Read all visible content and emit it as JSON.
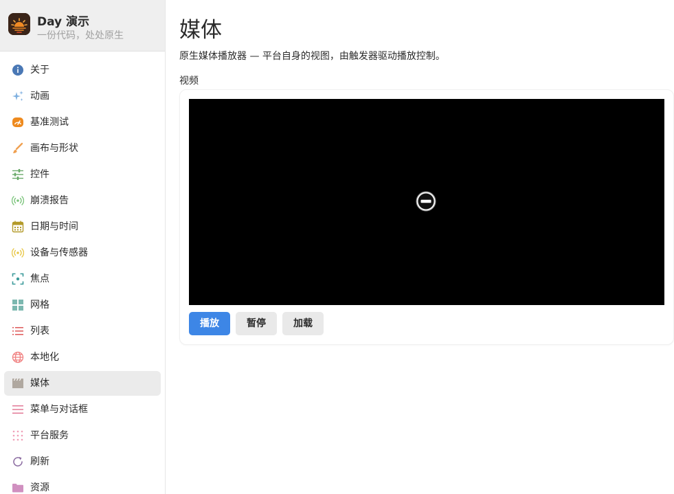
{
  "app": {
    "title": "Day 演示",
    "subtitle": "一份代码，处处原生"
  },
  "sidebar": {
    "items": [
      {
        "label": "关于",
        "icon": "info-icon",
        "color": "#4a78b5"
      },
      {
        "label": "动画",
        "icon": "sparkles-icon",
        "color": "#7fb0e0"
      },
      {
        "label": "基准测试",
        "icon": "speedometer-icon",
        "color": "#ee8a1e"
      },
      {
        "label": "画布与形状",
        "icon": "brush-icon",
        "color": "#f0a050"
      },
      {
        "label": "控件",
        "icon": "sliders-icon",
        "color": "#6aaa6a"
      },
      {
        "label": "崩溃报告",
        "icon": "broadcast-icon",
        "color": "#7cc47c"
      },
      {
        "label": "日期与时间",
        "icon": "calendar-icon",
        "color": "#b39a2a"
      },
      {
        "label": "设备与传感器",
        "icon": "sensor-icon",
        "color": "#e8c84a"
      },
      {
        "label": "焦点",
        "icon": "focus-icon",
        "color": "#3a9a9a"
      },
      {
        "label": "网格",
        "icon": "grid-icon",
        "color": "#7cb8b0"
      },
      {
        "label": "列表",
        "icon": "list-icon",
        "color": "#e06060"
      },
      {
        "label": "本地化",
        "icon": "globe-icon",
        "color": "#f08080"
      },
      {
        "label": "媒体",
        "icon": "film-icon",
        "color": "#b0a8a0",
        "active": true
      },
      {
        "label": "菜单与对话框",
        "icon": "menu-lines-icon",
        "color": "#e07090"
      },
      {
        "label": "平台服务",
        "icon": "dots-grid-icon",
        "color": "#f0a0b8"
      },
      {
        "label": "刷新",
        "icon": "refresh-icon",
        "color": "#8a6aa0"
      },
      {
        "label": "资源",
        "icon": "folder-icon",
        "color": "#d090c0"
      }
    ]
  },
  "main": {
    "title": "媒体",
    "description": "原生媒体播放器 — 平台自身的视图，由触发器驱动播放控制。",
    "section_label": "视频",
    "buttons": {
      "play": "播放",
      "pause": "暂停",
      "load": "加载"
    }
  },
  "colors": {
    "accent": "#3d86e6",
    "active_bg": "#ebebeb"
  }
}
